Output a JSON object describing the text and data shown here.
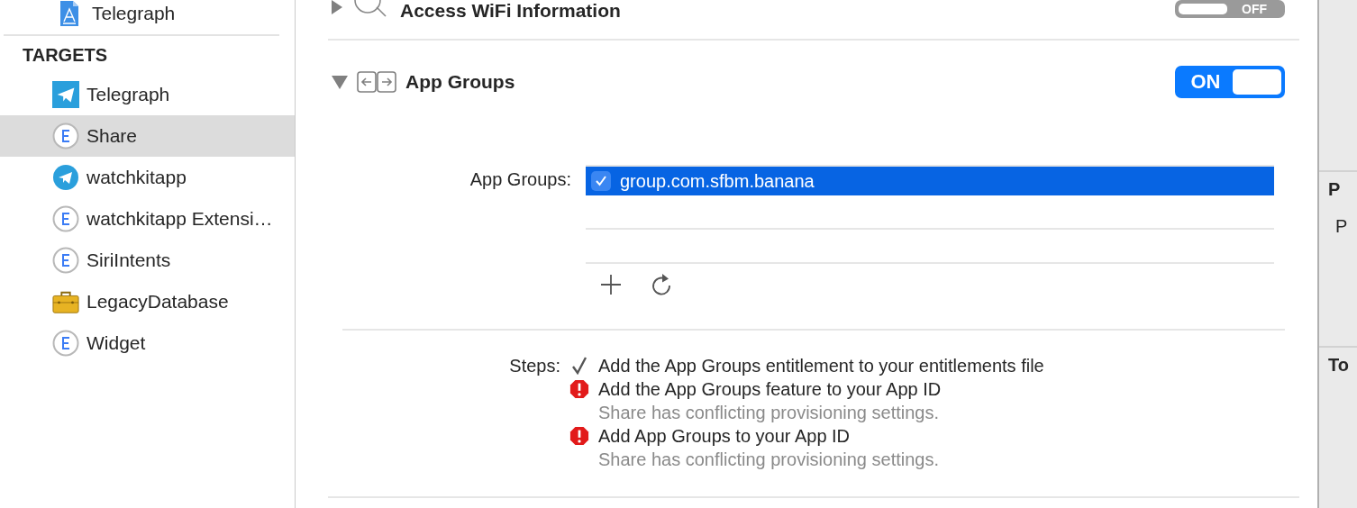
{
  "sidebar": {
    "project_item": {
      "label": "Telegraph",
      "kind": "project"
    },
    "section_title": "TARGETS",
    "targets": [
      {
        "label": "Telegraph",
        "kind": "app",
        "selected": false
      },
      {
        "label": "Share",
        "kind": "extension",
        "selected": true
      },
      {
        "label": "watchkitapp",
        "kind": "watch",
        "selected": false
      },
      {
        "label": "watchkitapp Extensi…",
        "kind": "extension",
        "selected": false
      },
      {
        "label": "SiriIntents",
        "kind": "extension",
        "selected": false
      },
      {
        "label": "LegacyDatabase",
        "kind": "framework",
        "selected": false
      },
      {
        "label": "Widget",
        "kind": "extension",
        "selected": false
      }
    ]
  },
  "capabilities": [
    {
      "title": "Access WiFi Information",
      "kind": "wifi",
      "expanded": false,
      "on": false,
      "switch_label": "OFF"
    },
    {
      "title": "App Groups",
      "kind": "groups",
      "expanded": true,
      "on": true,
      "switch_label": "ON",
      "field_label": "App Groups:",
      "groups": [
        {
          "name": "group.com.sfbm.banana",
          "checked": true,
          "selected": true
        }
      ],
      "steps_label": "Steps:",
      "steps": [
        {
          "text": "Add the App Groups entitlement to your entitlements file",
          "kind": "done"
        },
        {
          "text": "Add the App Groups feature to your App ID",
          "kind": "error",
          "detail": "Share has conflicting provisioning settings."
        },
        {
          "text": "Add App Groups to your App ID",
          "kind": "error",
          "detail": "Share has conflicting provisioning settings."
        }
      ]
    }
  ],
  "inspector": {
    "sections": [
      {
        "title": "P",
        "text": "P"
      },
      {
        "title": "To"
      }
    ]
  }
}
